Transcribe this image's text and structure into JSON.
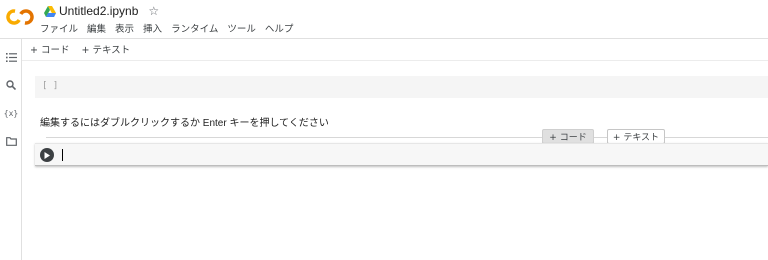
{
  "notebook": {
    "title": "Untitled2.ipynb"
  },
  "menu": {
    "items": [
      "ファイル",
      "編集",
      "表示",
      "挿入",
      "ランタイム",
      "ツール",
      "ヘルプ"
    ]
  },
  "toolbar": {
    "add_code": "+ コード",
    "add_text": "+ テキスト"
  },
  "cells": {
    "empty_code_bracket": "[ ]",
    "text_cell": "編集するにはダブルクリックするか Enter キーを押してください"
  },
  "insert_buttons": {
    "code": "+ コード",
    "text": "+ テキスト"
  },
  "icons": {
    "logo": "colab-logo",
    "drive": "drive-icon",
    "star": "star-icon",
    "toc": "table-of-contents-icon",
    "search": "search-icon",
    "variables": "variables-icon",
    "files": "folder-icon",
    "run": "play-icon"
  },
  "colors": {
    "logo_orange": "#f9ab00",
    "logo_dark_orange": "#e37400"
  }
}
